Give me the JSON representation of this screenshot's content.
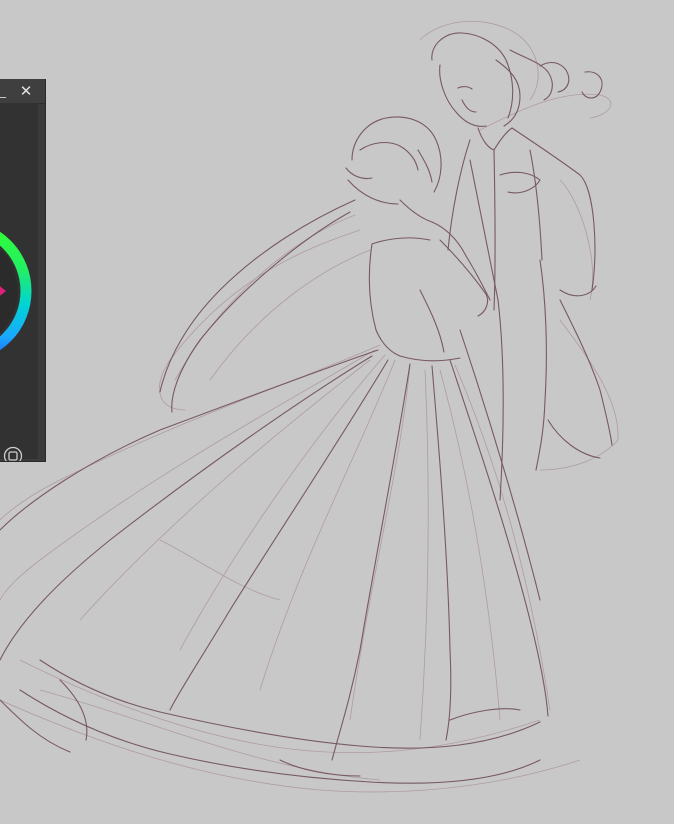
{
  "app": {
    "canvas_background": "#c8c8c8",
    "sketch_line_color": "#6b4a56",
    "sketch_line_light": "#9a7f88"
  },
  "color_panel": {
    "minimize_glyph": "_",
    "close_glyph": "✕",
    "panel_bg": "#3b3b3b",
    "selected_color": "#e0207a",
    "icons": [
      "minimize-icon",
      "close-icon",
      "color-wheel",
      "expand-icon"
    ]
  }
}
